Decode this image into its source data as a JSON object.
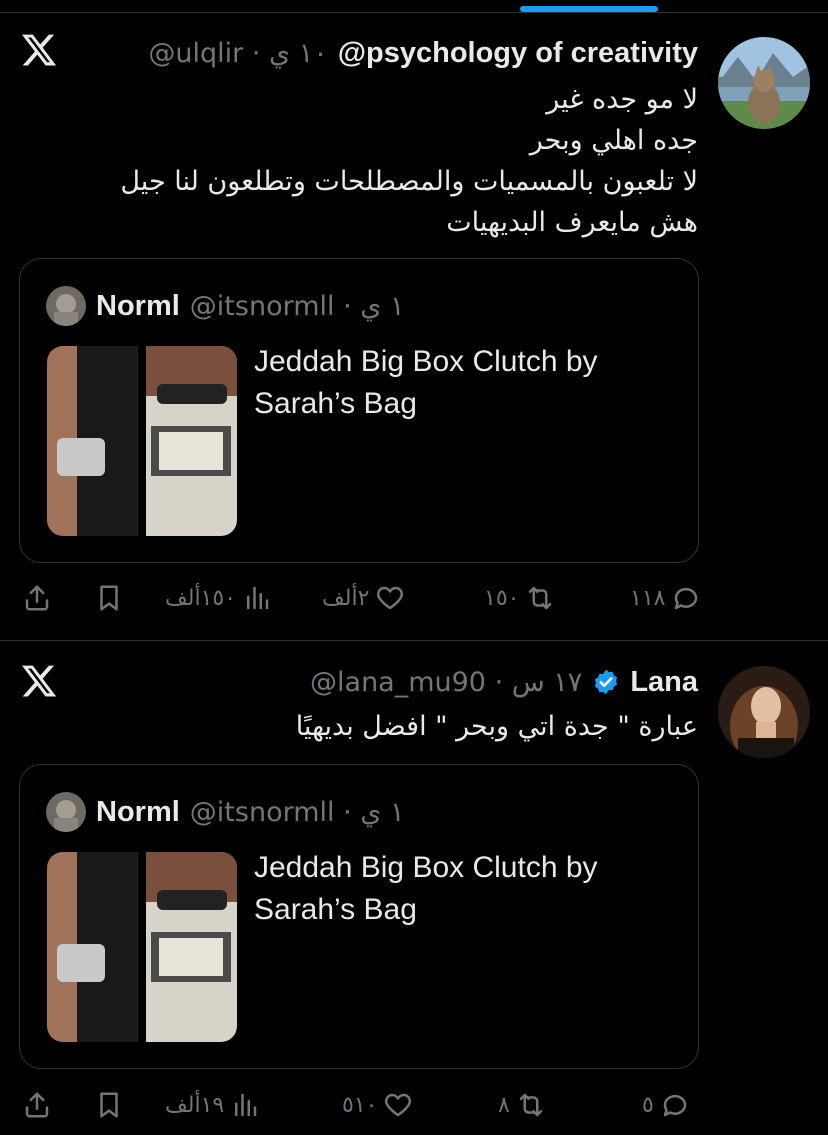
{
  "tweets": [
    {
      "display_name": "psychology of creativity",
      "handle_meta": "@ulqlir · ١٠ ي",
      "handle_prefix": "@",
      "verified": false,
      "lines": [
        "لا مو جده غير",
        "جده اهلي وبحر",
        "لا تلعبون بالمسميات والمصطلحات وتطلعون لنا جيل",
        "هش مايعرف البديهيات"
      ],
      "quote": {
        "name": "Norml",
        "meta": "@itsnormll · ١ ي",
        "title": "Jeddah Big Box Clutch by Sarah’s Bag"
      },
      "actions": {
        "reply": "١١٨",
        "retweet": "١٥٠",
        "like": "٢ألف",
        "views": "١٥٠ألف"
      }
    },
    {
      "display_name": "Lana",
      "handle_meta": "@lana_mu90 · ١٧ س",
      "verified": true,
      "lines": [
        "عبارة \" جدة اتي وبحر \" افضل بديهيًا"
      ],
      "quote": {
        "name": "Norml",
        "meta": "@itsnormll · ١ ي",
        "title": "Jeddah Big Box Clutch by Sarah’s Bag"
      },
      "actions": {
        "reply": "٥",
        "retweet": "٨",
        "like": "٥١٠",
        "views": "١٩ألف"
      }
    }
  ],
  "icons": {
    "app": "x-logo-icon",
    "reply": "reply-icon",
    "retweet": "retweet-icon",
    "like": "heart-icon",
    "views": "views-icon",
    "bookmark": "bookmark-icon",
    "share": "share-icon",
    "verified": "verified-badge-icon"
  },
  "colors": {
    "background": "#000000",
    "text": "#e7e9ea",
    "muted": "#71767b",
    "accent": "#1d9bf0",
    "border": "#2f3336"
  }
}
